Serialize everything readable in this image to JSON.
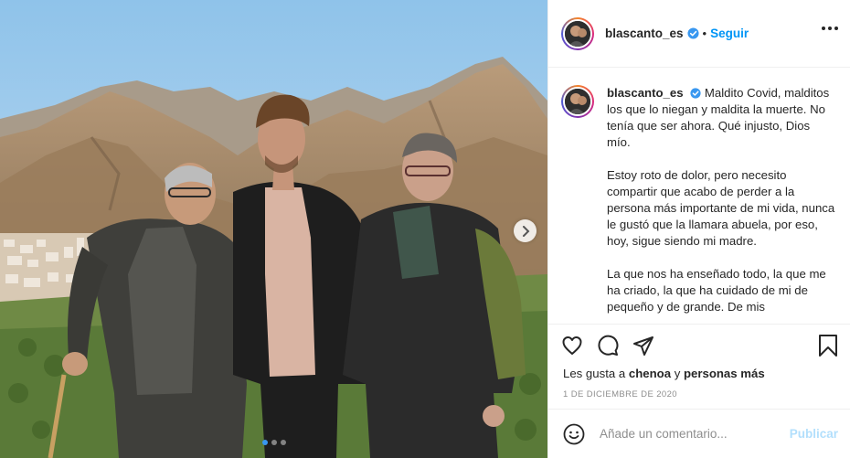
{
  "post": {
    "username": "blascanto_es",
    "header_separator": "•",
    "follow_label": "Seguir",
    "caption": {
      "username": "blascanto_es",
      "paragraphs": [
        "Maldito Covid, malditos los que lo niegan y maldita la muerte. No tenía que ser ahora. Qué injusto, Dios mío.",
        "Estoy roto de dolor, pero necesito compartir que acabo de perder a la persona más importante de mi vida, nunca le gustó que la llamara abuela, por eso, hoy, sigue siendo mi madre.",
        "La que nos ha enseñado todo, la que me ha criado, la que ha cuidado de mi de pequeño y de grande. De mis"
      ]
    },
    "likes": {
      "prefix": "Les gusta a",
      "user": "chenoa",
      "joiner": "y",
      "others": "personas más"
    },
    "date": "1 DE DICIEMBRE DE 2020",
    "comment": {
      "placeholder": "Añade un comentario...",
      "value": "",
      "publish_label": "Publicar"
    }
  },
  "carousel": {
    "slide_count": 3,
    "active_index": 0
  },
  "icons": {
    "header": [
      "verified-badge-icon",
      "more-options-icon"
    ],
    "actions": [
      "heart-icon",
      "comment-icon",
      "share-icon",
      "bookmark-icon"
    ],
    "comment": [
      "emoji-icon"
    ],
    "carousel": [
      "chevron-right-icon"
    ]
  },
  "colors": {
    "link_blue": "#0095f6",
    "publish_disabled": "#b2dffc",
    "verified_blue": "#3897f0",
    "text": "#262626",
    "muted": "#8e8e8e"
  }
}
